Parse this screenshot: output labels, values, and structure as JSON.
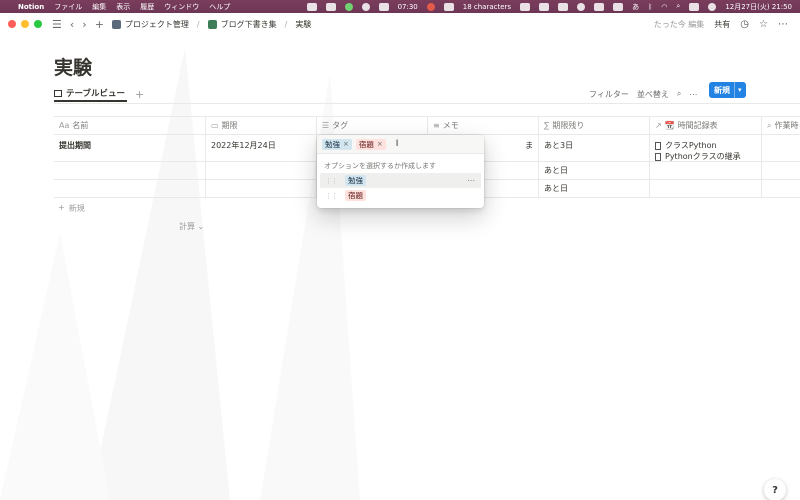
{
  "menubar": {
    "app": "Notion",
    "menus": [
      "ファイル",
      "編集",
      "表示",
      "履歴",
      "ウィンドウ",
      "ヘルプ"
    ],
    "clock_time": "07:30",
    "char_count": "18 characters",
    "ime": "あ",
    "datetime": "12月27日(火) 21:50"
  },
  "titlebar": {
    "breadcrumb": [
      "プロジェクト管理",
      "ブログ下書き集",
      "実験"
    ],
    "edited": "たった今 編集",
    "share": "共有"
  },
  "page": {
    "title": "実験"
  },
  "view": {
    "tab_label": "テーブルビュー",
    "filter": "フィルター",
    "sort": "並べ替え",
    "new_button": "新規"
  },
  "table": {
    "headers": {
      "name": "名前",
      "deadline": "期限",
      "tag": "タグ",
      "memo": "メモ",
      "remaining": "期限残り",
      "timelog": "時間記録表",
      "worker": "作業時"
    },
    "header_icons": {
      "name": "Aa",
      "remaining": "∑"
    },
    "rows": [
      {
        "name": "提出期間",
        "deadline": "2022年12月24日",
        "memo_partial": "ま",
        "remaining": "あと3日",
        "timelog": [
          "クラスPython",
          "Pythonクラスの継承"
        ]
      },
      {
        "name": "",
        "deadline": "",
        "remaining": "あと日",
        "timelog": []
      },
      {
        "name": "",
        "deadline": "",
        "remaining": "あと日",
        "timelog": []
      }
    ],
    "add_row": "新規",
    "calc": "計算"
  },
  "tag_picker": {
    "selected": [
      {
        "label": "勉強",
        "color": "#d3e5ef"
      },
      {
        "label": "宿題",
        "color": "#ffe2dd"
      }
    ],
    "hint": "オプションを選択するか作成します",
    "options": [
      {
        "label": "勉強",
        "color": "#d3e5ef"
      },
      {
        "label": "宿題",
        "color": "#ffe2dd"
      }
    ]
  },
  "help": "?",
  "colors": {
    "accent": "#2383e2",
    "menubar": "#7a3d5c"
  },
  "icons": [
    "apple-icon",
    "hamburger-icon",
    "back-icon",
    "forward-icon",
    "plus-icon",
    "clock-icon",
    "star-icon",
    "more-icon",
    "search-icon",
    "grid-icon",
    "drag-handle-icon",
    "close-icon",
    "text-cursor-icon",
    "document-icon"
  ]
}
